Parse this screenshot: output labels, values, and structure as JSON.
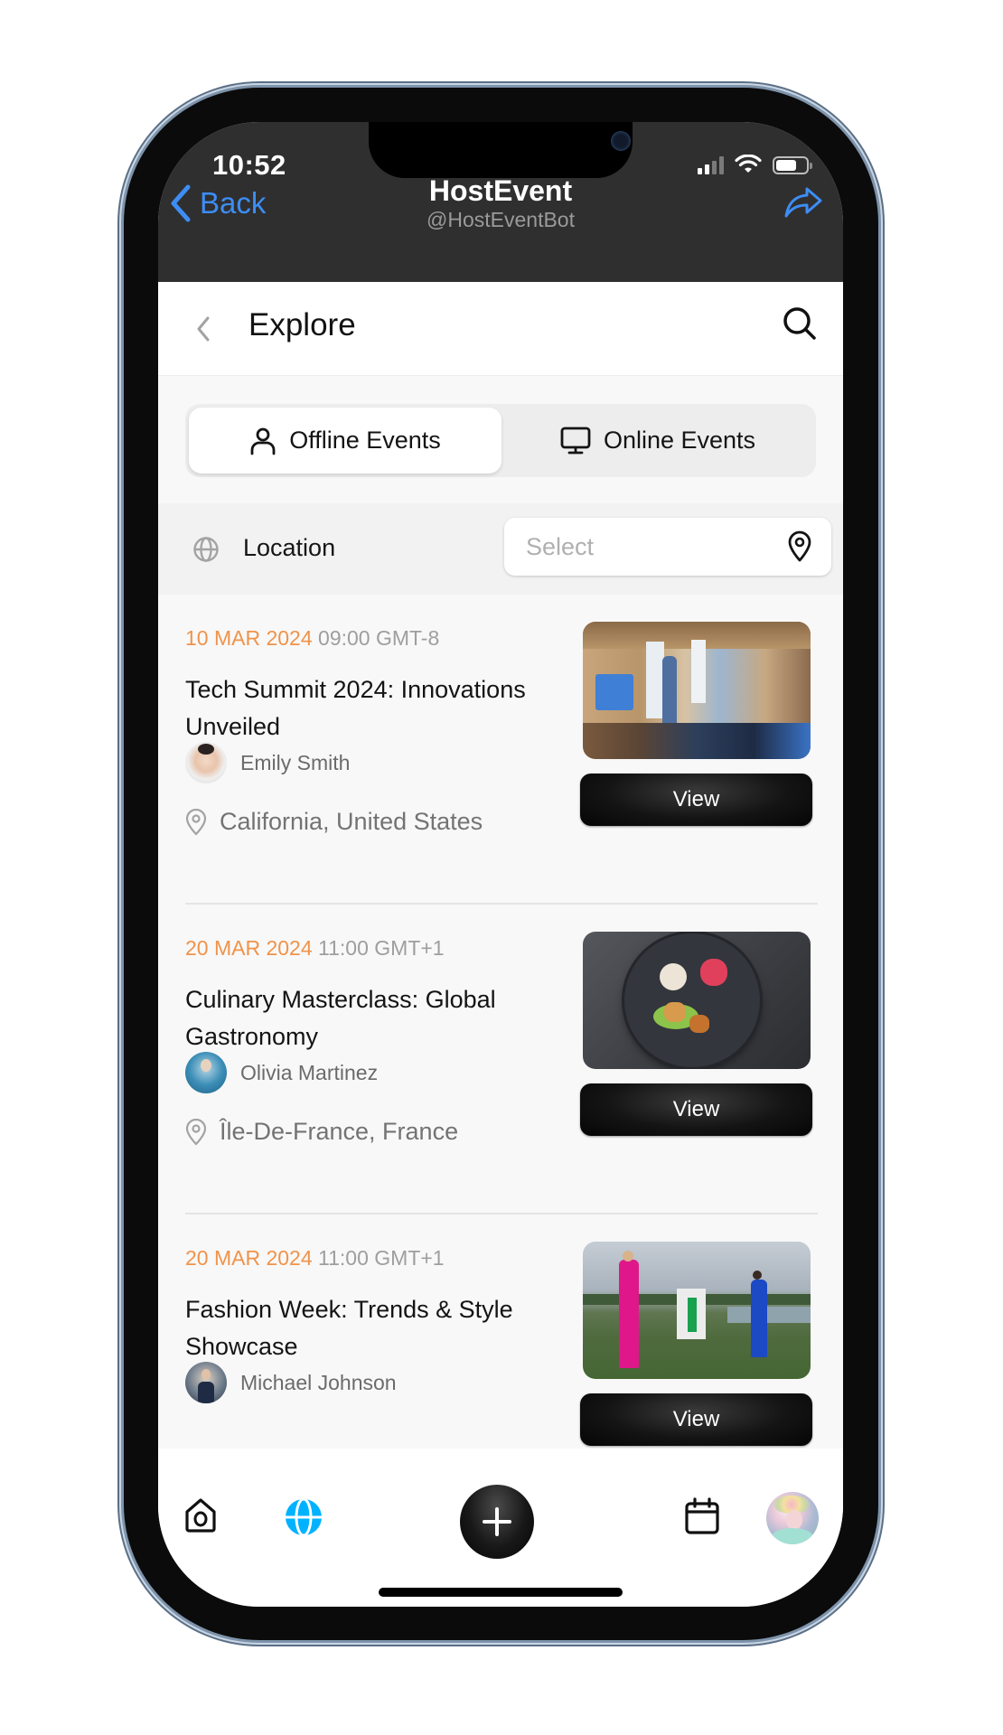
{
  "status_bar": {
    "time": "10:52"
  },
  "telegram_header": {
    "back_label": "Back",
    "bot_name": "HostEvent",
    "bot_handle": "@HostEventBot",
    "accent_color": "#3d8df5"
  },
  "explore_bar": {
    "title": "Explore"
  },
  "event_mode_tabs": [
    {
      "label": "Offline Events",
      "icon": "person-icon",
      "active": true
    },
    {
      "label": "Online Events",
      "icon": "monitor-icon",
      "active": false
    }
  ],
  "location_filter": {
    "label": "Location",
    "placeholder": "Select"
  },
  "events": [
    {
      "date": "10 MAR 2024",
      "time": "09:00 GMT-8",
      "title": "Tech Summit 2024: Innovations Unveiled",
      "host": "Emily Smith",
      "location": "California, United States",
      "image": "conference-room-presentation",
      "button_label": "View"
    },
    {
      "date": "20 MAR 2024",
      "time": "11:00 GMT+1",
      "title": "Culinary Masterclass: Global Gastronomy",
      "host": "Olivia Martinez",
      "location": "Île-De-France, France",
      "image": "plated-gourmet-dish",
      "button_label": "View"
    },
    {
      "date": "20 MAR 2024",
      "time": "11:00 GMT+1",
      "title": "Fashion Week: Trends & Style Showcase",
      "host": "Michael Johnson",
      "location": "",
      "image": "models-walking-outdoor-runway",
      "button_label": "View"
    }
  ],
  "tab_bar": {
    "items": [
      {
        "name": "home",
        "icon": "home-icon",
        "active": false
      },
      {
        "name": "explore",
        "icon": "globe-icon",
        "active": true
      },
      {
        "name": "create",
        "icon": "plus-icon",
        "active": false
      },
      {
        "name": "calendar",
        "icon": "calendar-icon",
        "active": false
      },
      {
        "name": "profile",
        "icon": "avatar",
        "active": false
      }
    ],
    "active_color": "#00b2ff"
  },
  "colors": {
    "date_accent": "#f0934a",
    "header_bg": "#2f2f2f"
  }
}
